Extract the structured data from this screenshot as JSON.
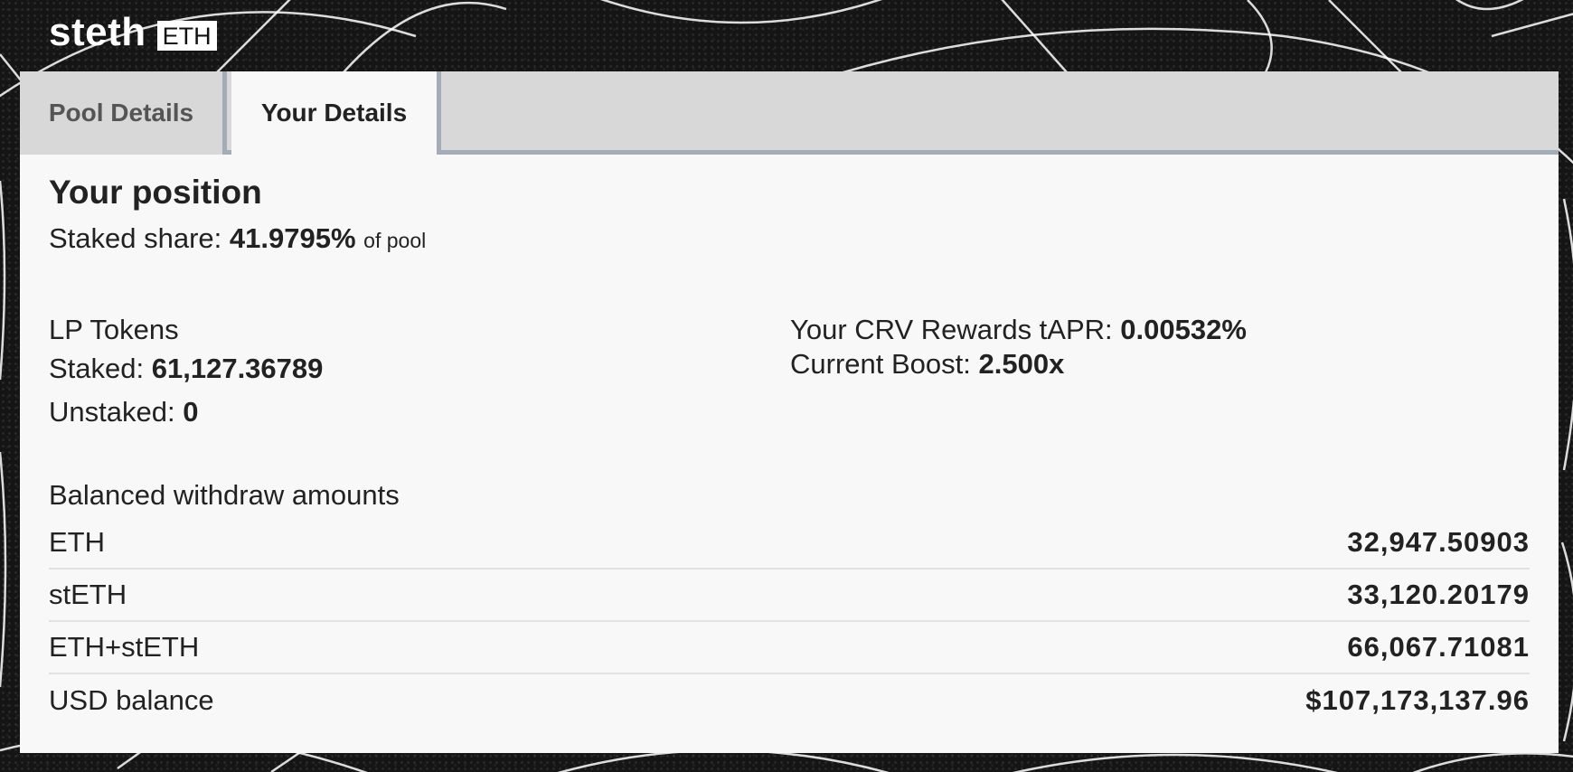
{
  "pool": {
    "name": "steth",
    "badge": "ETH"
  },
  "tabs": [
    {
      "label": "Pool Details",
      "active": false
    },
    {
      "label": "Your Details",
      "active": true
    }
  ],
  "position": {
    "title": "Your position",
    "staked_share_label": "Staked share:",
    "staked_share_value": "41.9795%",
    "staked_share_suffix": "of pool"
  },
  "lp_tokens": {
    "heading": "LP Tokens",
    "staked_label": "Staked:",
    "staked_value": "61,127.36789",
    "unstaked_label": "Unstaked:",
    "unstaked_value": "0"
  },
  "rewards": {
    "tapr_label": "Your CRV Rewards tAPR:",
    "tapr_value": "0.00532%",
    "boost_label": "Current Boost:",
    "boost_value": "2.500x"
  },
  "withdraw": {
    "heading": "Balanced withdraw amounts",
    "rows": [
      {
        "label": "ETH",
        "value": "32,947.50903"
      },
      {
        "label": "stETH",
        "value": "33,120.20179"
      },
      {
        "label": "ETH+stETH",
        "value": "66,067.71081"
      },
      {
        "label": "USD balance",
        "value": "$107,173,137.96"
      }
    ]
  },
  "colors": {
    "background": "#151515",
    "panel": "#f8f8f8",
    "tabbar": "#d8d8d8",
    "tab_border": "#a4acb8",
    "text": "#222222"
  }
}
